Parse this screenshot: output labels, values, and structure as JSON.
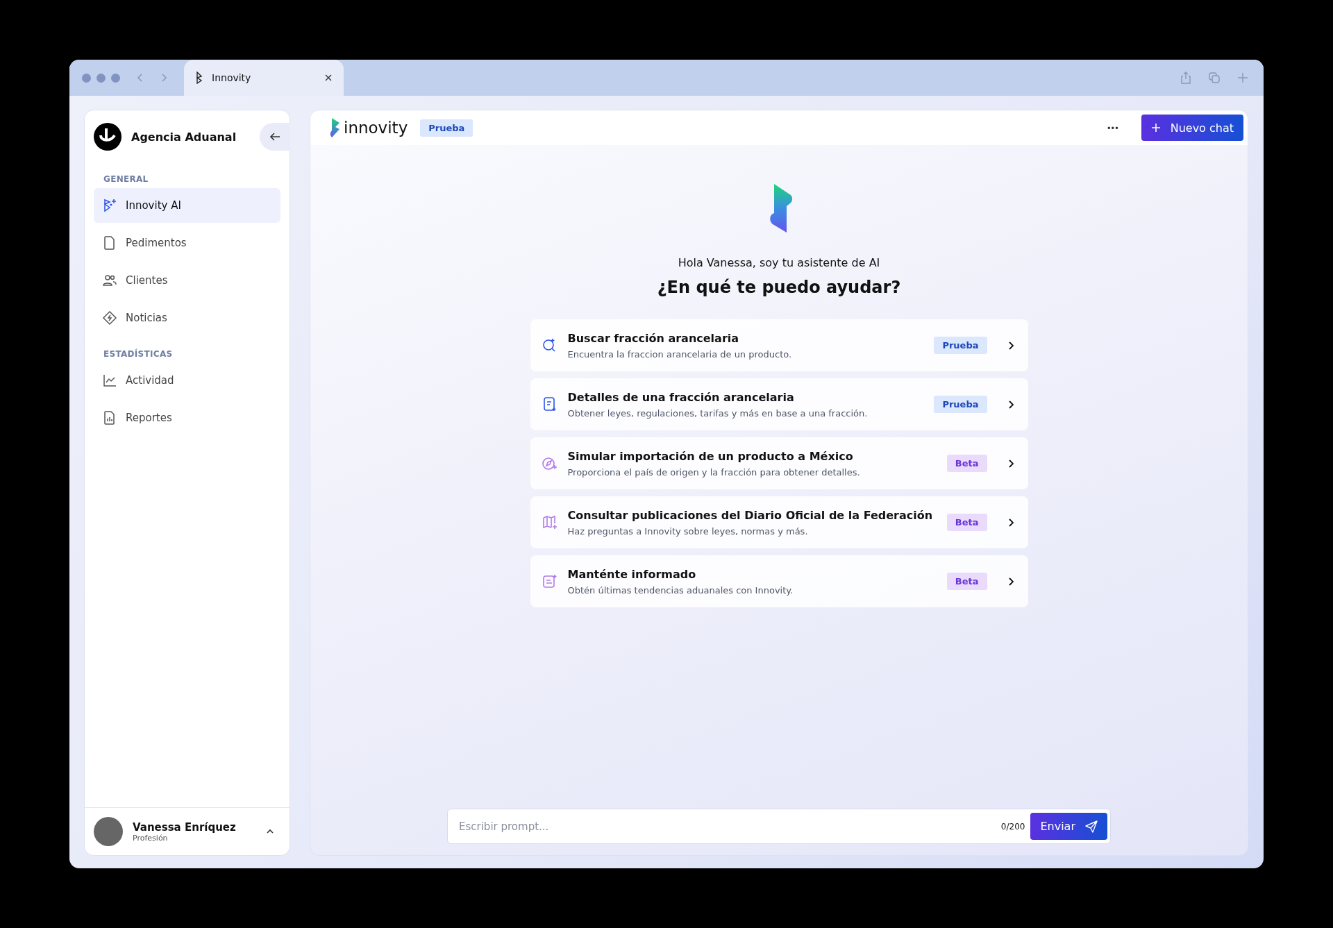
{
  "browser": {
    "tabs": [
      {
        "title": "Innovity",
        "selected": true
      }
    ]
  },
  "sidebar": {
    "org": "Agencia Aduanal",
    "sections": [
      {
        "title": "GENERAL",
        "items": [
          {
            "label": "Innovity AI",
            "selected": true
          },
          {
            "label": "Pedimentos",
            "selected": false
          },
          {
            "label": "Clientes",
            "selected": false
          },
          {
            "label": "Noticias",
            "selected": false
          }
        ]
      },
      {
        "title": "ESTADÍSTICAS",
        "items": [
          {
            "label": "Actividad",
            "selected": false
          },
          {
            "label": "Reportes",
            "selected": false
          }
        ]
      }
    ],
    "user": {
      "name": "Vanessa Enríquez",
      "role": "Profesión"
    }
  },
  "header": {
    "logo": "innovity",
    "badge": "Prueba",
    "more": "•••",
    "new_chat": "Nuevo chat"
  },
  "greeting": "Hola Vanessa, soy tu asistente de AI",
  "question": "¿En qué te puedo ayudar?",
  "cards": [
    {
      "title": "Buscar fracción arancelaria",
      "subtitle": "Encuentra la fraccion arancelaria de un producto.",
      "tag": "Prueba",
      "kind": "prueba"
    },
    {
      "title": "Detalles de una fracción arancelaria",
      "subtitle": "Obtener leyes, regulaciones, tarifas y más en base a una fracción.",
      "tag": "Prueba",
      "kind": "prueba"
    },
    {
      "title": "Simular importación de un producto a México",
      "subtitle": "Proporciona el país de origen y la fracción para obtener detalles.",
      "tag": "Beta",
      "kind": "beta"
    },
    {
      "title": "Consultar publicaciones del Diario Oficial de la Federación",
      "subtitle": "Haz preguntas a Innovity sobre leyes, normas y más.",
      "tag": "Beta",
      "kind": "beta"
    },
    {
      "title": "Manténte informado",
      "subtitle": "Obtén últimas tendencias aduanales con Innovity.",
      "tag": "Beta",
      "kind": "beta"
    }
  ],
  "prompt": {
    "placeholder": "Escribir prompt...",
    "counter": "0/200",
    "send": "Enviar"
  }
}
